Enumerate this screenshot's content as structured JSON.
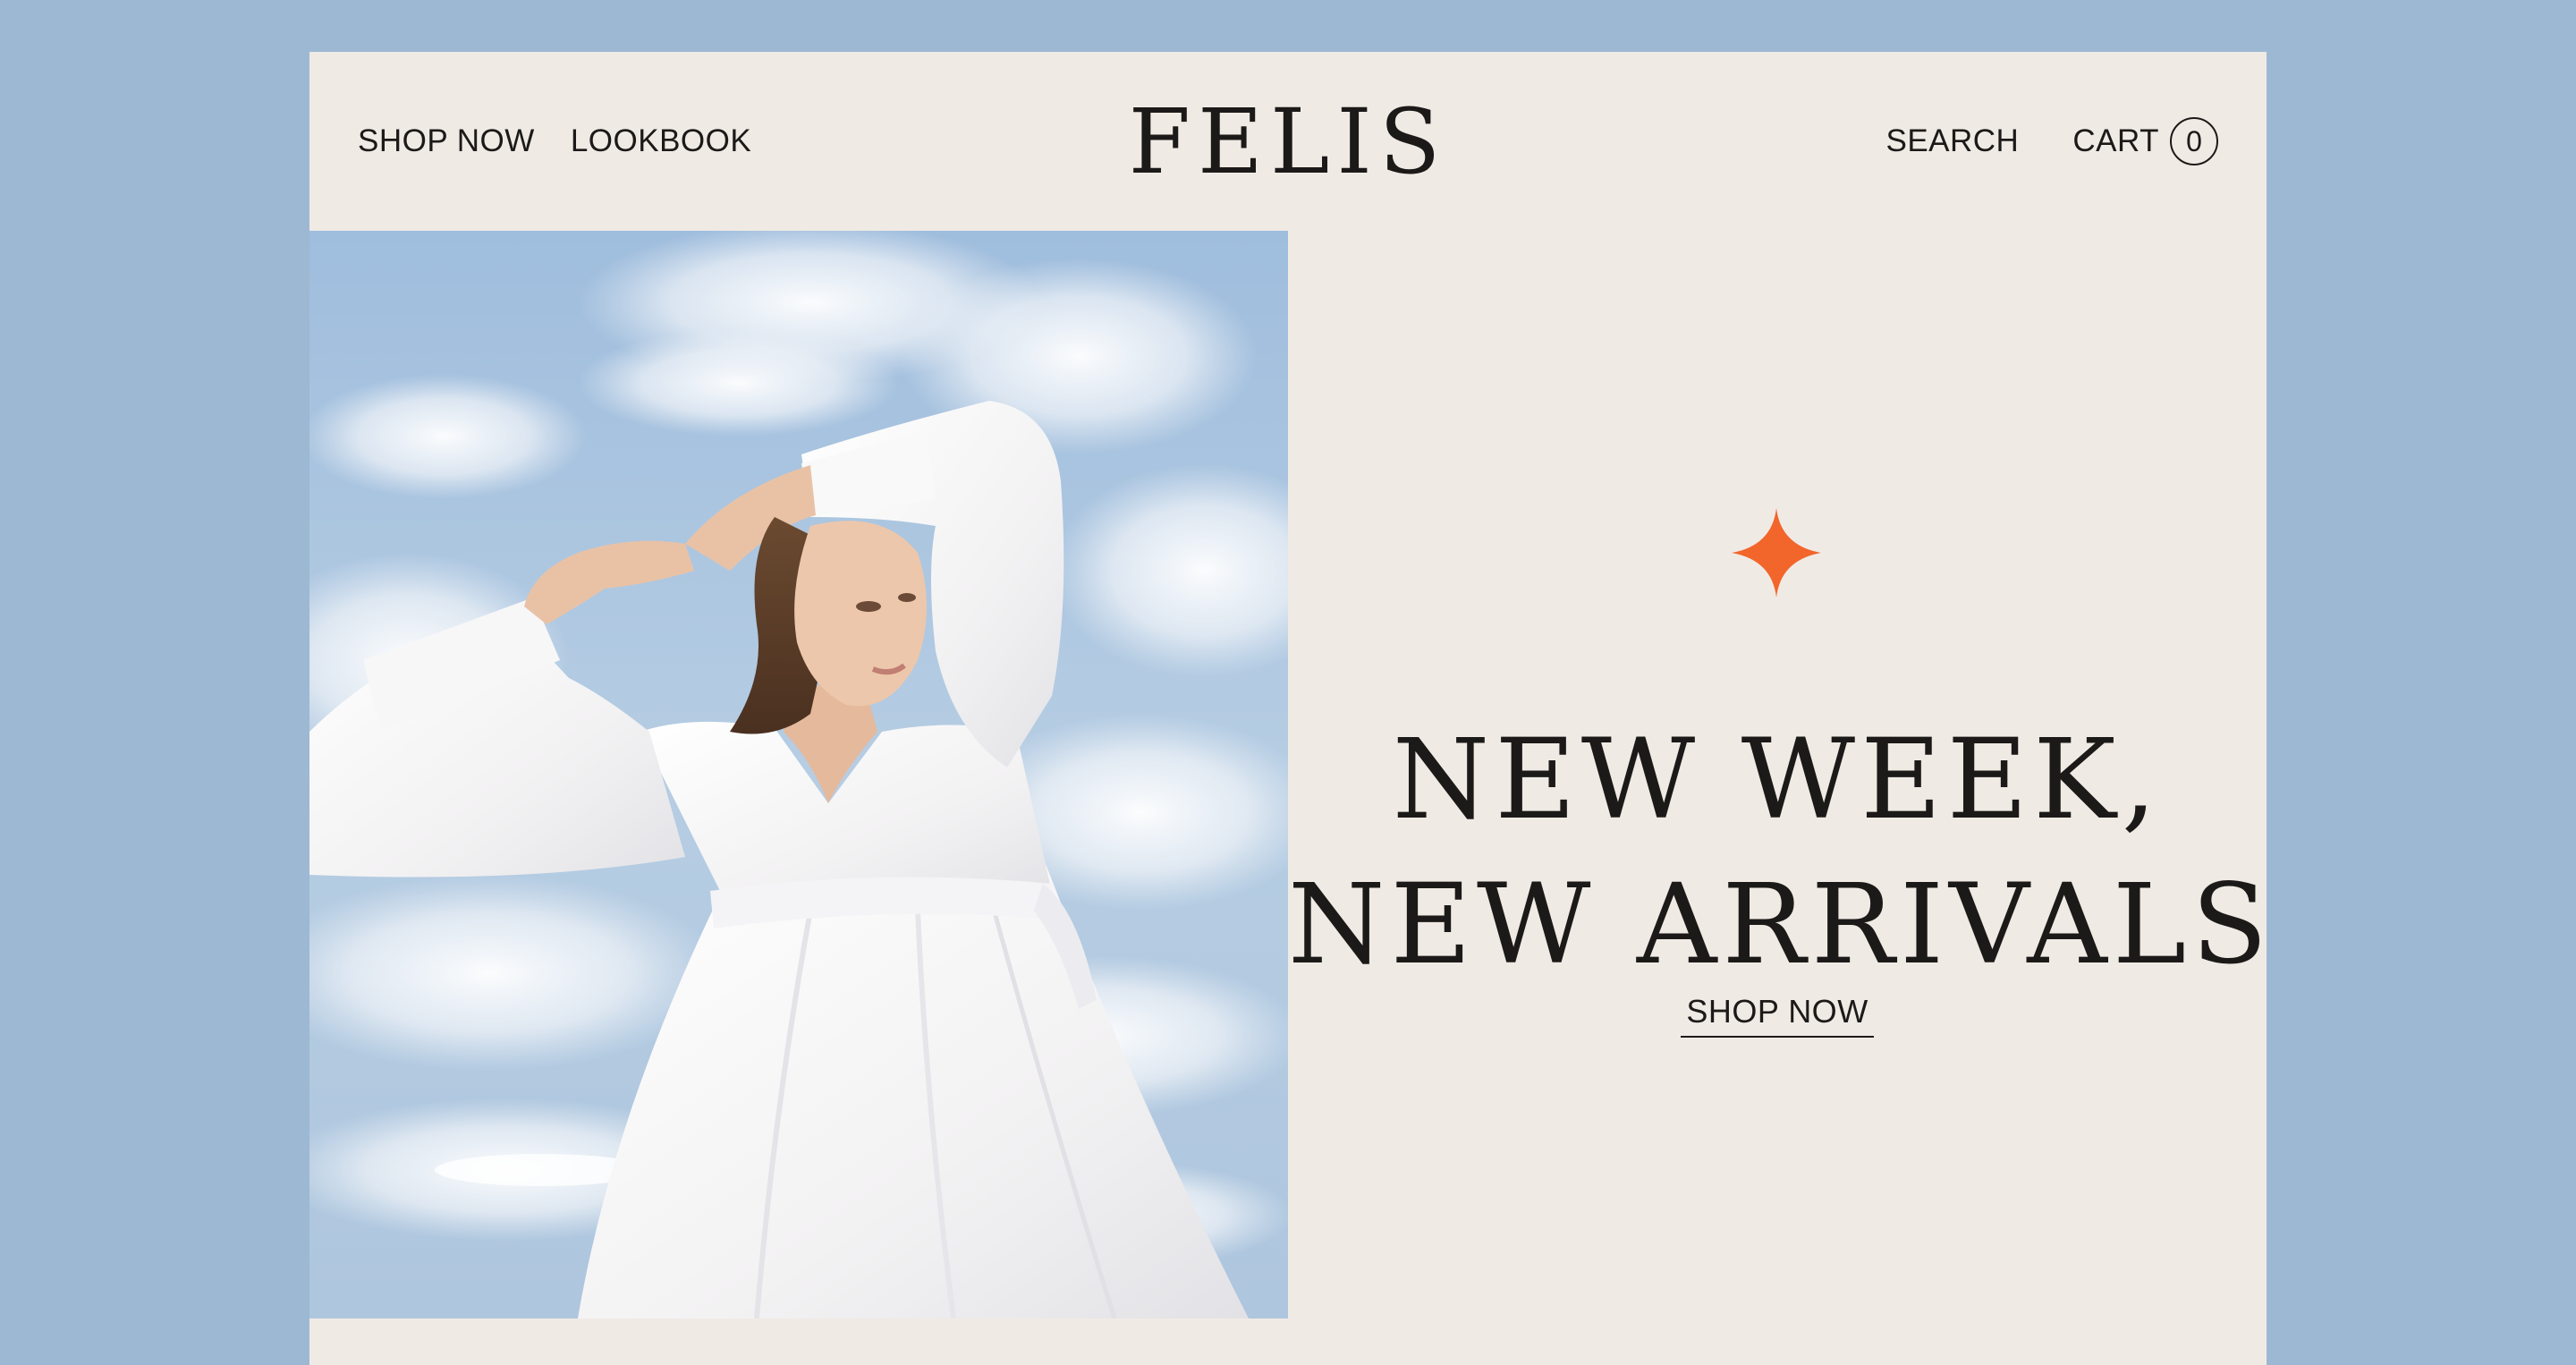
{
  "colors": {
    "background": "#9db8d2",
    "page": "#f0eae5",
    "text": "#1c1a18",
    "accent": "#f2652b"
  },
  "header": {
    "nav_left": [
      {
        "label": "SHOP NOW"
      },
      {
        "label": "LOOKBOOK"
      }
    ],
    "logo": "FELIS",
    "nav_right": {
      "search_label": "SEARCH",
      "cart_label": "CART",
      "cart_count": "0"
    }
  },
  "hero": {
    "image": "woman-in-white-dress-against-sky",
    "icon": "sparkle-star-icon",
    "headline_line1": "NEW WEEK,",
    "headline_line2": "NEW ARRIVALS",
    "cta_label": "SHOP NOW"
  }
}
